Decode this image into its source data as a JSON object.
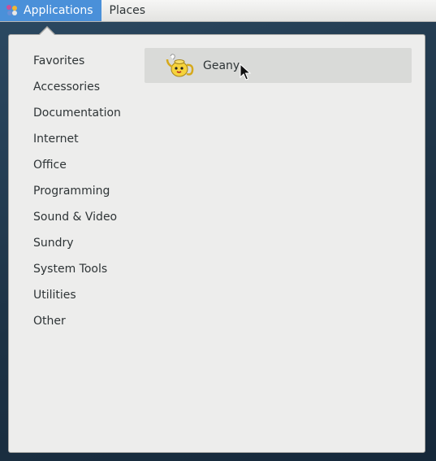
{
  "topbar": {
    "applications_label": "Applications",
    "places_label": "Places"
  },
  "categories": [
    "Favorites",
    "Accessories",
    "Documentation",
    "Internet",
    "Office",
    "Programming",
    "Sound & Video",
    "Sundry",
    "System Tools",
    "Utilities",
    "Other"
  ],
  "apps": [
    {
      "label": "Geany",
      "icon": "geany-teapot-icon",
      "hovered": true
    }
  ],
  "colors": {
    "accent": "#4a90d9",
    "menu_bg": "#ededec",
    "hover_bg": "#d9dad8",
    "text": "#2e3436"
  }
}
